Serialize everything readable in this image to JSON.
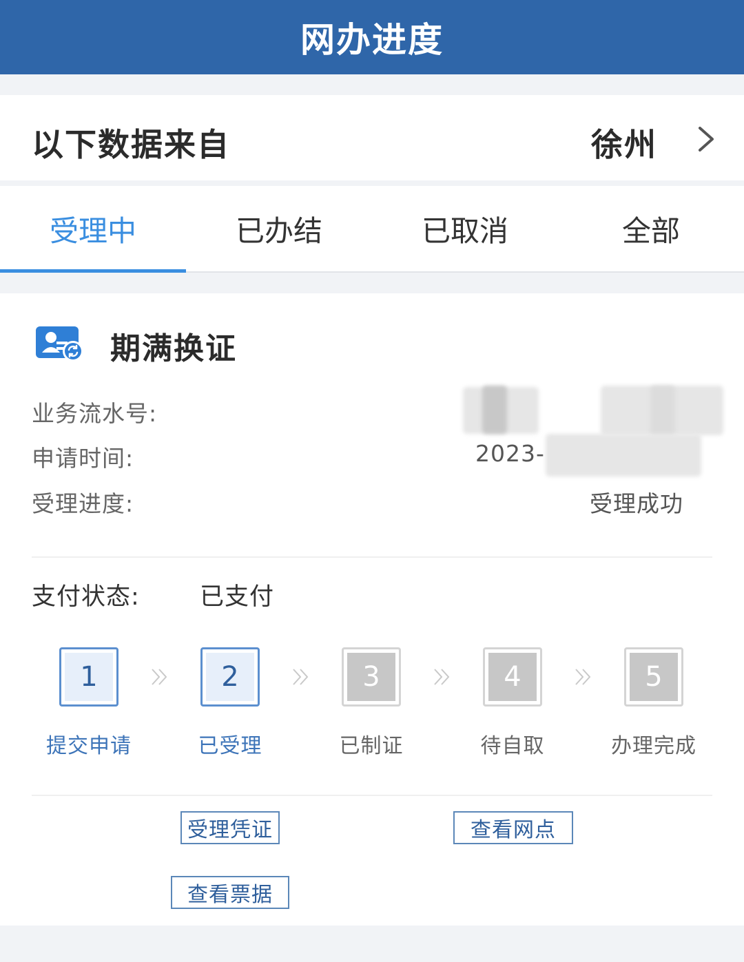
{
  "header": {
    "title": "网办进度"
  },
  "source": {
    "label": "以下数据来自",
    "city": "徐州"
  },
  "tabs": [
    {
      "label": "受理中",
      "active": true
    },
    {
      "label": "已办结",
      "active": false
    },
    {
      "label": "已取消",
      "active": false
    },
    {
      "label": "全部",
      "active": false
    }
  ],
  "card": {
    "title": "期满换证",
    "info": [
      {
        "label": "业务流水号:",
        "value": ""
      },
      {
        "label": "申请时间:",
        "value": "2023-"
      },
      {
        "label": "受理进度:",
        "value": "受理成功"
      }
    ],
    "payment": {
      "label": "支付状态:",
      "value": "已支付"
    },
    "steps": [
      {
        "num": "1",
        "label": "提交申请",
        "active": true
      },
      {
        "num": "2",
        "label": "已受理",
        "active": true
      },
      {
        "num": "3",
        "label": "已制证",
        "active": false
      },
      {
        "num": "4",
        "label": "待自取",
        "active": false
      },
      {
        "num": "5",
        "label": "办理完成",
        "active": false
      }
    ],
    "buttons": {
      "receipt": "受理凭证",
      "outlets": "查看网点",
      "invoice": "查看票据"
    }
  },
  "colors": {
    "header": "#2f66a9",
    "accent": "#3a8ee0",
    "step_active": "#5b8fcf",
    "step_inactive": "#c7c7c7"
  }
}
